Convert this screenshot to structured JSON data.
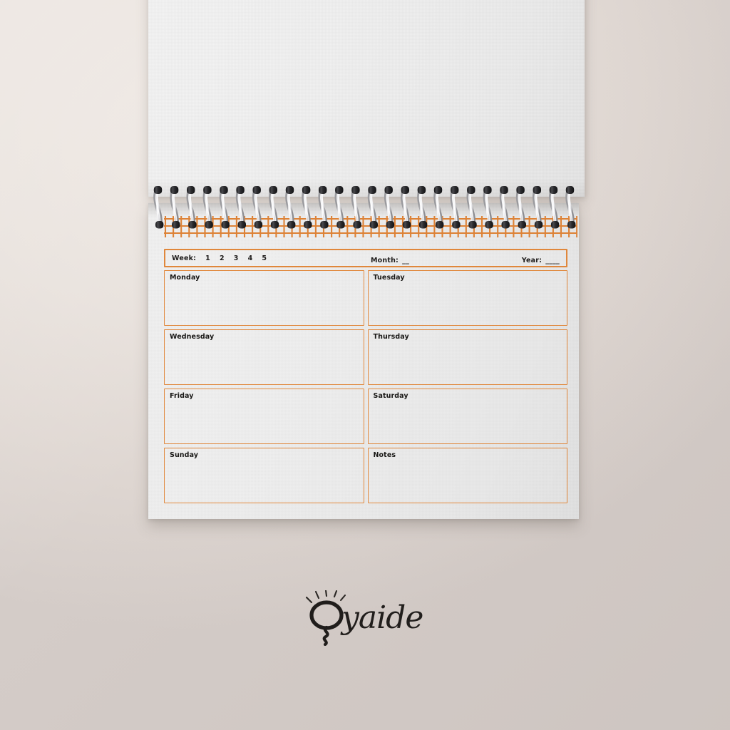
{
  "document": {
    "type": "weekly-planner-notepad",
    "accent_color": "#E0873B",
    "paper_color": "#EFEFEF",
    "background_color": "#E7E0DB",
    "ink_color": "#1E1C1B"
  },
  "header": {
    "week_label": "Week:",
    "week_numbers": [
      "1",
      "2",
      "3",
      "4",
      "5"
    ],
    "month_label": "Month:",
    "month_value": "__",
    "year_label": "Year:",
    "year_value": "____"
  },
  "cells": [
    {
      "name": "Monday",
      "value": ""
    },
    {
      "name": "Tuesday",
      "value": ""
    },
    {
      "name": "Wednesday",
      "value": ""
    },
    {
      "name": "Thursday",
      "value": ""
    },
    {
      "name": "Friday",
      "value": ""
    },
    {
      "name": "Saturday",
      "value": ""
    },
    {
      "name": "Sunday",
      "value": ""
    },
    {
      "name": "Notes",
      "value": ""
    }
  ],
  "binding": {
    "ring_count": 26,
    "ring_color": "#2B2B2D",
    "wire_color": "#D9D9DB"
  },
  "brand": {
    "name": "Oyaide",
    "mark": "lightbulb-icon",
    "word": "yaide"
  }
}
